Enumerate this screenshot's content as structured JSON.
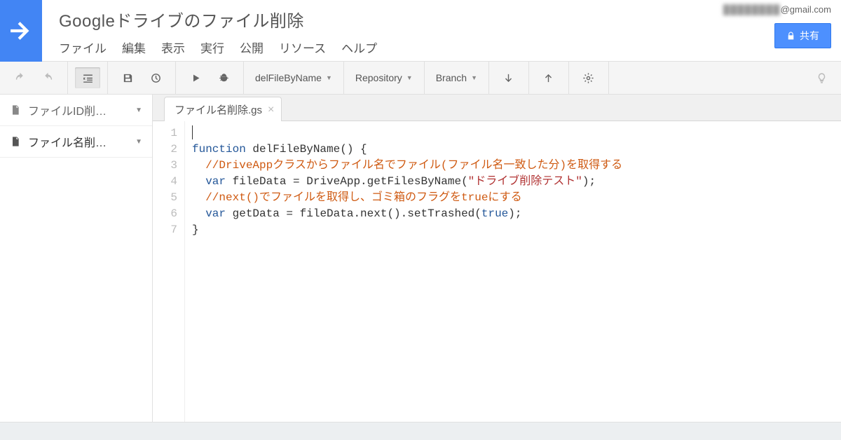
{
  "header": {
    "project_title": "Googleドライブのファイル削除",
    "user_email_suffix": "@gmail.com",
    "share_label": "共有"
  },
  "menubar": {
    "file": "ファイル",
    "edit": "編集",
    "view": "表示",
    "run": "実行",
    "publish": "公開",
    "resources": "リソース",
    "help": "ヘルプ"
  },
  "toolbar": {
    "function_select": "delFileByName",
    "repository": "Repository",
    "branch": "Branch"
  },
  "sidebar": {
    "items": [
      {
        "label": "ファイルID削…",
        "active": false
      },
      {
        "label": "ファイル名削…",
        "active": true
      }
    ]
  },
  "tabs": [
    {
      "label": "ファイル名削除.gs"
    }
  ],
  "code": {
    "lines": [
      1,
      2,
      3,
      4,
      5,
      6,
      7
    ],
    "l1_kw": "function",
    "l1_fn": " delFileByName() {",
    "l2": "  //DriveAppクラスからファイル名でファイル(ファイル名一致した分)を取得する",
    "l3_kw1": "  var",
    "l3_a": " fileData = DriveApp.getFilesByName(",
    "l3_str": "\"ドライブ削除テスト\"",
    "l3_b": ");",
    "l4": "  //next()でファイルを取得し、ゴミ箱のフラグをtrueにする",
    "l5_kw1": "  var",
    "l5_a": " getData = fileData.next().setTrashed(",
    "l5_bf": "true",
    "l5_b": ");",
    "l6": "}"
  }
}
